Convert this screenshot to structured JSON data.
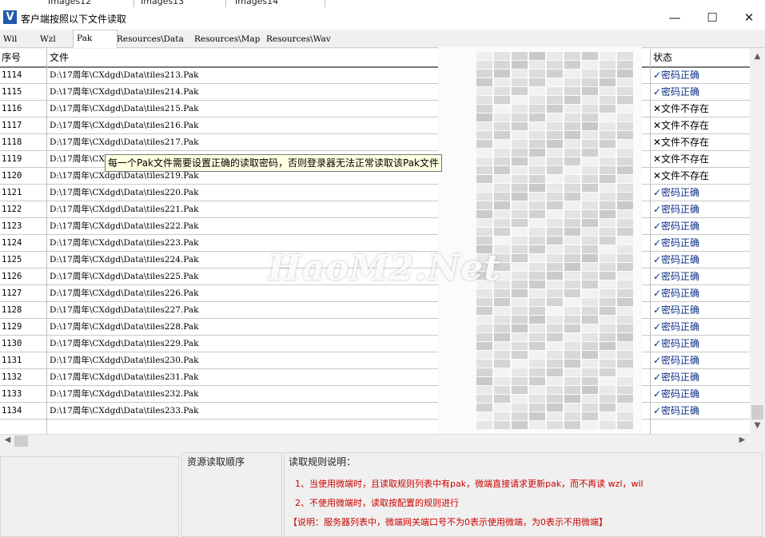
{
  "background_window": {
    "columns": [
      "Images12",
      "Images13",
      "Images14"
    ]
  },
  "window": {
    "title": "客户端按照以下文件读取",
    "icon_letter": "V",
    "minimize_glyph": "—",
    "maximize_glyph": "☐",
    "close_glyph": "✕"
  },
  "tabs": [
    {
      "label": "Wil",
      "active": false
    },
    {
      "label": "Wzl",
      "active": false
    },
    {
      "label": "Pak",
      "active": true
    },
    {
      "label": "Resources\\Data",
      "active": false
    },
    {
      "label": "Resources\\Map",
      "active": false
    },
    {
      "label": "Resources\\Wav",
      "active": false
    }
  ],
  "table": {
    "headers": {
      "num": "序号",
      "file": "文件",
      "status": "状态"
    },
    "rows": [
      {
        "num": "1114",
        "file": "D:\\17周年\\CXdgd\\Data\\tiles213.Pak",
        "status": "✓密码正确",
        "ok": true
      },
      {
        "num": "1115",
        "file": "D:\\17周年\\CXdgd\\Data\\tiles214.Pak",
        "status": "✓密码正确",
        "ok": true
      },
      {
        "num": "1116",
        "file": "D:\\17周年\\CXdgd\\Data\\tiles215.Pak",
        "status": "✕文件不存在",
        "ok": false
      },
      {
        "num": "1117",
        "file": "D:\\17周年\\CXdgd\\Data\\tiles216.Pak",
        "status": "✕文件不存在",
        "ok": false
      },
      {
        "num": "1118",
        "file": "D:\\17周年\\CXdgd\\Data\\tiles217.Pak",
        "status": "✕文件不存在",
        "ok": false
      },
      {
        "num": "1119",
        "file": "D:\\17周年\\CX",
        "status": "✕文件不存在",
        "ok": false
      },
      {
        "num": "1120",
        "file": "D:\\17周年\\CXdgd\\Data\\tiles219.Pak",
        "status": "✕文件不存在",
        "ok": false
      },
      {
        "num": "1121",
        "file": "D:\\17周年\\CXdgd\\Data\\tiles220.Pak",
        "status": "✓密码正确",
        "ok": true
      },
      {
        "num": "1122",
        "file": "D:\\17周年\\CXdgd\\Data\\tiles221.Pak",
        "status": "✓密码正确",
        "ok": true
      },
      {
        "num": "1123",
        "file": "D:\\17周年\\CXdgd\\Data\\tiles222.Pak",
        "status": "✓密码正确",
        "ok": true
      },
      {
        "num": "1124",
        "file": "D:\\17周年\\CXdgd\\Data\\tiles223.Pak",
        "status": "✓密码正确",
        "ok": true
      },
      {
        "num": "1125",
        "file": "D:\\17周年\\CXdgd\\Data\\tiles224.Pak",
        "status": "✓密码正确",
        "ok": true
      },
      {
        "num": "1126",
        "file": "D:\\17周年\\CXdgd\\Data\\tiles225.Pak",
        "status": "✓密码正确",
        "ok": true
      },
      {
        "num": "1127",
        "file": "D:\\17周年\\CXdgd\\Data\\tiles226.Pak",
        "status": "✓密码正确",
        "ok": true
      },
      {
        "num": "1128",
        "file": "D:\\17周年\\CXdgd\\Data\\tiles227.Pak",
        "status": "✓密码正确",
        "ok": true
      },
      {
        "num": "1129",
        "file": "D:\\17周年\\CXdgd\\Data\\tiles228.Pak",
        "status": "✓密码正确",
        "ok": true
      },
      {
        "num": "1130",
        "file": "D:\\17周年\\CXdgd\\Data\\tiles229.Pak",
        "status": "✓密码正确",
        "ok": true
      },
      {
        "num": "1131",
        "file": "D:\\17周年\\CXdgd\\Data\\tiles230.Pak",
        "status": "✓密码正确",
        "ok": true
      },
      {
        "num": "1132",
        "file": "D:\\17周年\\CXdgd\\Data\\tiles231.Pak",
        "status": "✓密码正确",
        "ok": true
      },
      {
        "num": "1133",
        "file": "D:\\17周年\\CXdgd\\Data\\tiles232.Pak",
        "status": "✓密码正确",
        "ok": true
      },
      {
        "num": "1134",
        "file": "D:\\17周年\\CXdgd\\Data\\tiles233.Pak",
        "status": "✓密码正确",
        "ok": true
      }
    ]
  },
  "tooltip": "每一个Pak文件需要设置正确的读取密码，否则登录器无法正常读取该Pak文件",
  "watermark": "HaoM2.Net",
  "bottom": {
    "resource_order_label": "资源读取顺序",
    "rules_title": "读取规则说明：",
    "rules": [
      "1、当使用微端时，且读取规则列表中有pak，微端直接请求更新pak，而不再读 wzl，wil",
      "2、不使用微端时，读取按配置的规则进行",
      "【说明：服务器列表中，微端网关端口号不为0表示使用微端，为0表示不用微端】"
    ]
  },
  "colors": {
    "ok_status": "#0b2e86",
    "rule_text": "#cc0000",
    "tooltip_bg": "#ffffe1",
    "app_icon": "#1e5aa8"
  }
}
